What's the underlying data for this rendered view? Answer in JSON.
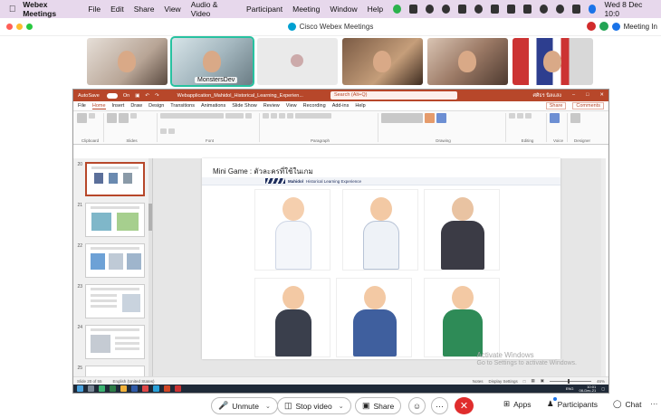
{
  "menubar": {
    "app_name": "Webex Meetings",
    "items": [
      "File",
      "Edit",
      "Share",
      "View",
      "Audio & Video",
      "Participant",
      "Meeting",
      "Window",
      "Help"
    ],
    "clock": "Wed 8 Dec  10:0"
  },
  "titlebar": {
    "title": "Cisco Webex Meetings",
    "meeting_info": "Meeting In"
  },
  "participants": [
    {
      "name": "",
      "active": false
    },
    {
      "name": "MonstersDev",
      "active": true
    },
    {
      "name": "",
      "active": false
    },
    {
      "name": "",
      "active": false
    },
    {
      "name": "",
      "active": false
    },
    {
      "name": "",
      "active": false
    }
  ],
  "ppt": {
    "autosave": "AutoSave",
    "autosave_state": "On",
    "file_name": "Webapplication_Mahidol_Historical_Learning_Experien...",
    "search_placeholder": "Search (Alt+Q)",
    "user_name": "ศศิธร นิลแสง",
    "menus": [
      "File",
      "Home",
      "Insert",
      "Draw",
      "Design",
      "Transitions",
      "Animations",
      "Slide Show",
      "Review",
      "View",
      "Recording",
      "Add-ins",
      "Help"
    ],
    "share": "Share",
    "comments": "Comments",
    "ribbon_groups": [
      "Clipboard",
      "Slides",
      "Font",
      "Paragraph",
      "Drawing",
      "Editing",
      "Voice",
      "Designer"
    ],
    "thumbnails": [
      "20",
      "21",
      "22",
      "23",
      "24",
      "25"
    ],
    "slide": {
      "title": "Mini Game : ตัวละครที่ใช้ในเกม",
      "banner_brand": "Mahidol",
      "banner_text": "Historical Learning Experience"
    },
    "watermark_line1": "Activate Windows",
    "watermark_line2": "Go to Settings to activate Windows.",
    "status_left": "Slide 20 of 55",
    "status_lang": "English (United States)",
    "status_notes": "Notes",
    "status_display": "Display Settings",
    "status_zoom": "46%",
    "taskbar_time": "10:01",
    "taskbar_date": "08-Dec-21",
    "taskbar_lang": "ENG"
  },
  "controls": {
    "unmute": "Unmute",
    "stop_video": "Stop video",
    "share": "Share",
    "apps": "Apps",
    "participants": "Participants",
    "chat": "Chat",
    "more": "···"
  }
}
